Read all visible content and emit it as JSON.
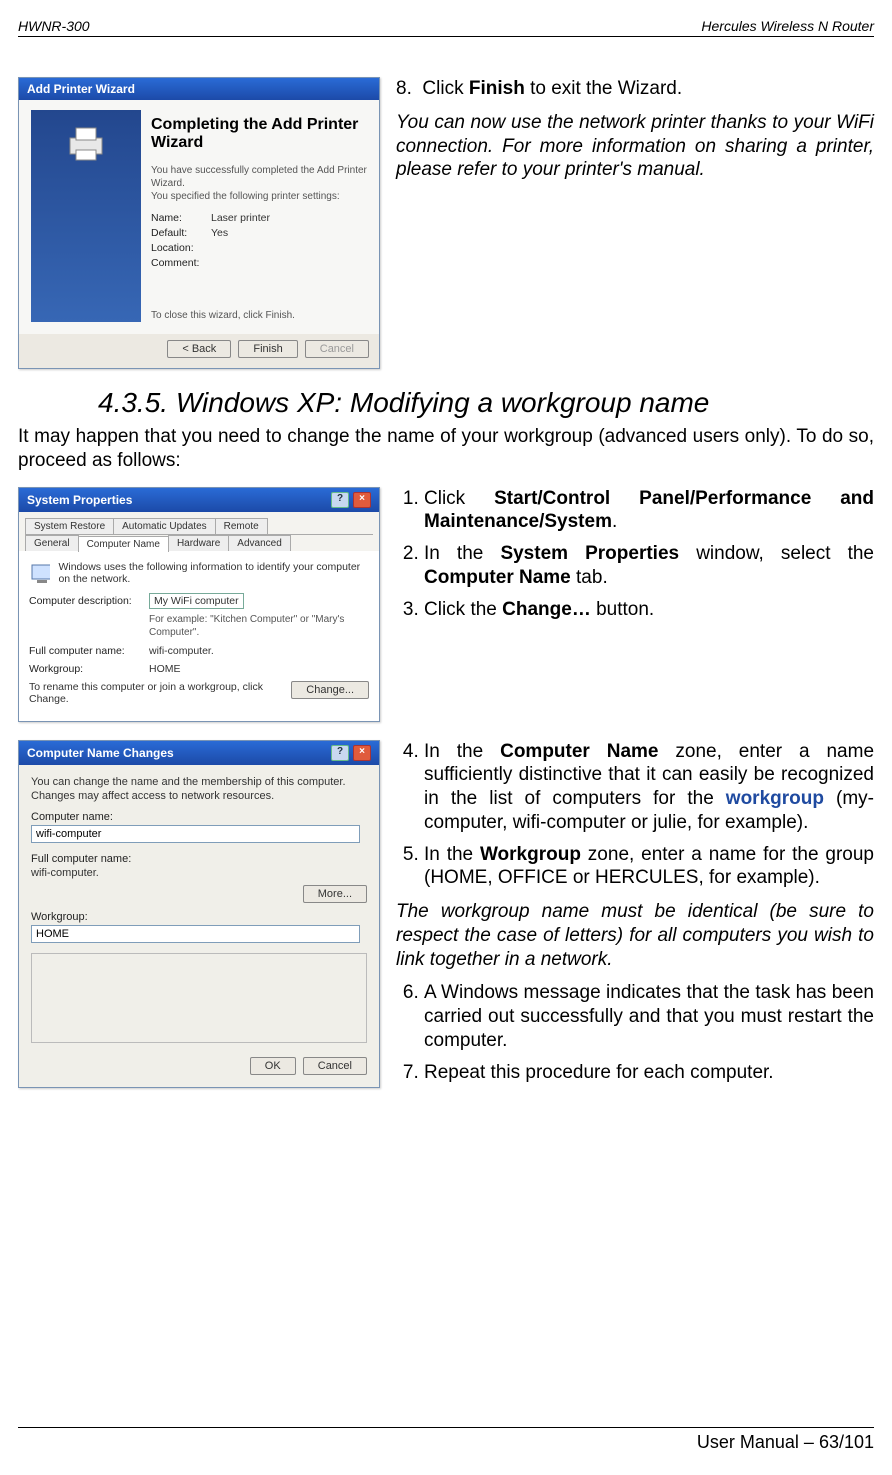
{
  "header": {
    "left": "HWNR-300",
    "right": "Hercules Wireless N Router"
  },
  "footer": "User Manual – 63/101",
  "section_heading": "4.3.5. Windows XP: Modifying a workgroup name",
  "intro_para": "It may happen that you need to change the name of your workgroup (advanced users only).  To do so, proceed as follows:",
  "wizard": {
    "window_title": "Add Printer Wizard",
    "heading": "Completing the Add Printer Wizard",
    "line1": "You have successfully completed the Add Printer Wizard.",
    "line2": "You specified the following printer settings:",
    "fields": {
      "name": "Laser printer",
      "default": "Yes",
      "location": "",
      "comment": ""
    },
    "bottom_hint": "To close this wizard, click Finish.",
    "buttons": {
      "back": "< Back",
      "finish": "Finish",
      "cancel": "Cancel"
    }
  },
  "wizard_side_text": {
    "step8": "Click Finish to exit the Wizard.",
    "note": "You can now use the network printer thanks to your WiFi connection.  For more information on sharing a printer, please refer to your printer's manual."
  },
  "sysprops": {
    "window_title": "System Properties",
    "tabs_row1": [
      "System Restore",
      "Automatic Updates",
      "Remote"
    ],
    "tabs_row2": [
      "General",
      "Computer Name",
      "Hardware",
      "Advanced"
    ],
    "selected_tab": "Computer Name",
    "hint": "Windows uses the following information to identify your computer on the network.",
    "desc_label": "Computer description:",
    "desc_value": "My WiFi computer",
    "desc_example": "For example: \"Kitchen Computer\" or \"Mary's Computer\".",
    "full_label": "Full computer name:",
    "full_value": "wifi-computer.",
    "wg_label": "Workgroup:",
    "wg_value": "HOME",
    "rename_hint": "To rename this computer or join a workgroup, click Change.",
    "change_btn": "Change..."
  },
  "sysprops_side": {
    "s1_pre": "Click ",
    "s1_bold": "Start/Control Panel/Performance and Maintenance/System",
    "s2_pre": "In the ",
    "s2_b1": "System Properties",
    "s2_mid": " window, select the ",
    "s2_b2": "Computer Name",
    "s2_post": " tab.",
    "s3_pre": "Click the ",
    "s3_b": "Change…",
    "s3_post": " button."
  },
  "cnc": {
    "window_title": "Computer Name Changes",
    "hint": "You can change the name and the membership of this computer. Changes may affect access to network resources.",
    "cname_label": "Computer name:",
    "cname_value": "wifi-computer",
    "fcn_label": "Full computer name:",
    "fcn_value": "wifi-computer.",
    "more_btn": "More...",
    "wg_label": "Workgroup:",
    "wg_value": "HOME",
    "ok": "OK",
    "cancel": "Cancel"
  },
  "cnc_side": {
    "s4_pre": "In the ",
    "s4_b": "Computer Name",
    "s4_mid": " zone, enter a name sufficiently distinctive that it can easily be recognized in the list of computers for the ",
    "s4_link": "workgroup",
    "s4_post": " (my-computer, wifi-computer or julie, for example).",
    "s5_pre": "In the ",
    "s5_b": "Workgroup",
    "s5_post": " zone, enter a name for the group (HOME, OFFICE or HERCULES, for example).",
    "note": "The workgroup name must be identical (be sure to respect the case of letters) for all computers you wish to link together in a network.",
    "s6": "A Windows message indicates that the task has been carried out successfully and that you must restart the computer.",
    "s7": "Repeat this procedure for each computer."
  }
}
